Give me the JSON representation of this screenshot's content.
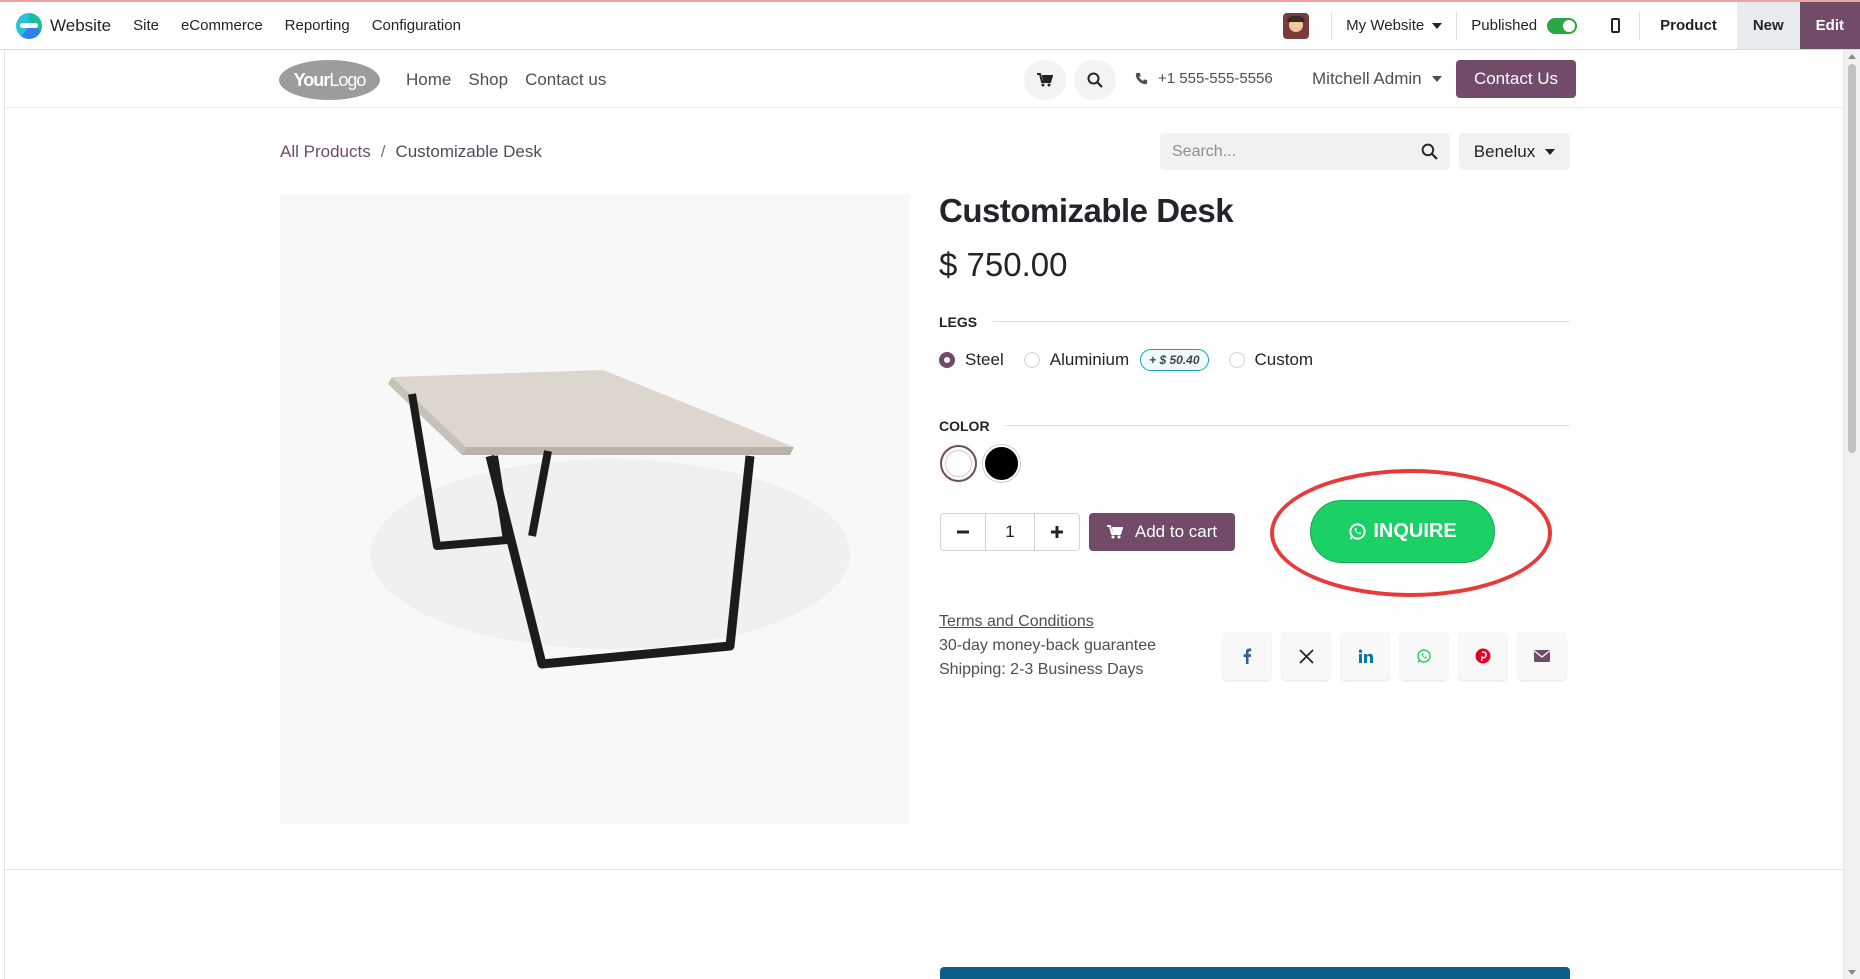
{
  "backend_bar": {
    "app_name": "Website",
    "menus": [
      "Site",
      "eCommerce",
      "Reporting",
      "Configuration"
    ],
    "website_selector": "My Website",
    "published_label": "Published",
    "published": true,
    "product_button": "Product",
    "new_button": "New",
    "edit_button": "Edit"
  },
  "site_header": {
    "logo_text_bold": "Your",
    "logo_text_light": "Logo",
    "nav": [
      "Home",
      "Shop",
      "Contact us"
    ],
    "phone": "+1 555-555-5556",
    "user": "Mitchell Admin",
    "contact_button": "Contact Us"
  },
  "breadcrumb": {
    "parent": "All Products",
    "separator": "/",
    "current": "Customizable Desk"
  },
  "search": {
    "placeholder": "Search..."
  },
  "pricelist": "Benelux",
  "product": {
    "name": "Customizable Desk",
    "price": "$ 750.00",
    "attributes": {
      "legs": {
        "label": "LEGS",
        "options": [
          "Steel",
          "Aluminium",
          "Custom"
        ],
        "selected": "Steel",
        "aluminium_extra": "+ $ 50.40"
      },
      "color": {
        "label": "COLOR",
        "swatches": [
          "#ffffff",
          "#000000"
        ],
        "selected": "#ffffff"
      }
    },
    "quantity": "1",
    "add_to_cart": "Add to cart",
    "inquire": "INQUIRE",
    "terms": "Terms and Conditions",
    "guarantee": "30-day money-back guarantee",
    "shipping": "Shipping: 2-3 Business Days",
    "share_icons": [
      "facebook-icon",
      "x-twitter-icon",
      "linkedin-icon",
      "whatsapp-icon",
      "pinterest-icon",
      "email-icon"
    ]
  },
  "colors": {
    "brand": "#714b67",
    "inquire_green": "#1bd165",
    "annotation_red": "#e83a3a"
  }
}
